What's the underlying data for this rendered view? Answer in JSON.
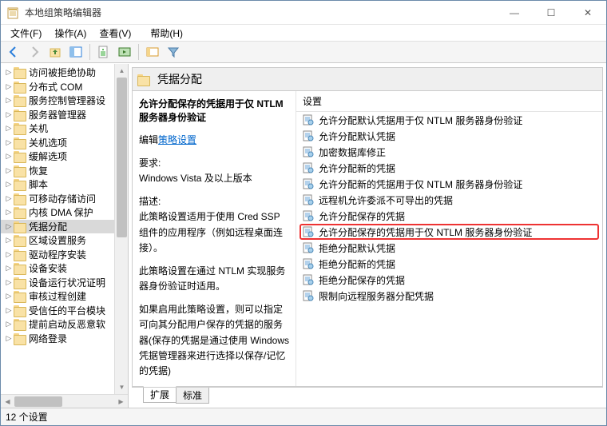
{
  "window": {
    "title": "本地组策略编辑器",
    "btn_min": "—",
    "btn_max": "☐",
    "btn_close": "✕"
  },
  "menu": [
    "文件(F)",
    "操作(A)",
    "查看(V)",
    "帮助(H)"
  ],
  "tree": {
    "items": [
      {
        "label": "访问被拒绝协助"
      },
      {
        "label": "分布式 COM"
      },
      {
        "label": "服务控制管理器设"
      },
      {
        "label": "服务器管理器"
      },
      {
        "label": "关机"
      },
      {
        "label": "关机选项"
      },
      {
        "label": "缓解选项"
      },
      {
        "label": "恢复"
      },
      {
        "label": "脚本"
      },
      {
        "label": "可移动存储访问"
      },
      {
        "label": "内核 DMA 保护"
      },
      {
        "label": "凭据分配",
        "selected": true
      },
      {
        "label": "区域设置服务"
      },
      {
        "label": "驱动程序安装"
      },
      {
        "label": "设备安装"
      },
      {
        "label": "设备运行状况证明"
      },
      {
        "label": "审核过程创建"
      },
      {
        "label": "受信任的平台模块"
      },
      {
        "label": "提前启动反恶意软"
      },
      {
        "label": "网络登录"
      }
    ]
  },
  "banner": {
    "title": "凭据分配"
  },
  "desc": {
    "title": "允许分配保存的凭据用于仅 NTLM 服务器身份验证",
    "edit_prefix": "编辑",
    "edit_link": "策略设置",
    "req_label": "要求:",
    "req_text": "Windows Vista 及以上版本",
    "desc_label": "描述:",
    "desc_text1": "此策略设置适用于使用 Cred SSP 组件的应用程序（例如远程桌面连接）。",
    "desc_text2": "此策略设置在通过 NTLM 实现服务器身份验证时适用。",
    "desc_text3": "如果启用此策略设置，则可以指定可向其分配用户保存的凭据的服务器(保存的凭据是通过使用 Windows 凭据管理器来进行选择以保存/记忆的凭据)"
  },
  "list": {
    "header": "设置",
    "items": [
      {
        "label": "允许分配默认凭据用于仅 NTLM 服务器身份验证"
      },
      {
        "label": "允许分配默认凭据"
      },
      {
        "label": "加密数据库修正"
      },
      {
        "label": "允许分配新的凭据"
      },
      {
        "label": "允许分配新的凭据用于仅 NTLM 服务器身份验证"
      },
      {
        "label": "远程机允许委派不可导出的凭据"
      },
      {
        "label": "允许分配保存的凭据"
      },
      {
        "label": "允许分配保存的凭据用于仅 NTLM 服务器身份验证",
        "highlighted": true
      },
      {
        "label": "拒绝分配默认凭据"
      },
      {
        "label": "拒绝分配新的凭据"
      },
      {
        "label": "拒绝分配保存的凭据"
      },
      {
        "label": "限制向远程服务器分配凭据"
      }
    ]
  },
  "tabs": {
    "active": "扩展",
    "inactive": "标准"
  },
  "status": "12 个设置"
}
